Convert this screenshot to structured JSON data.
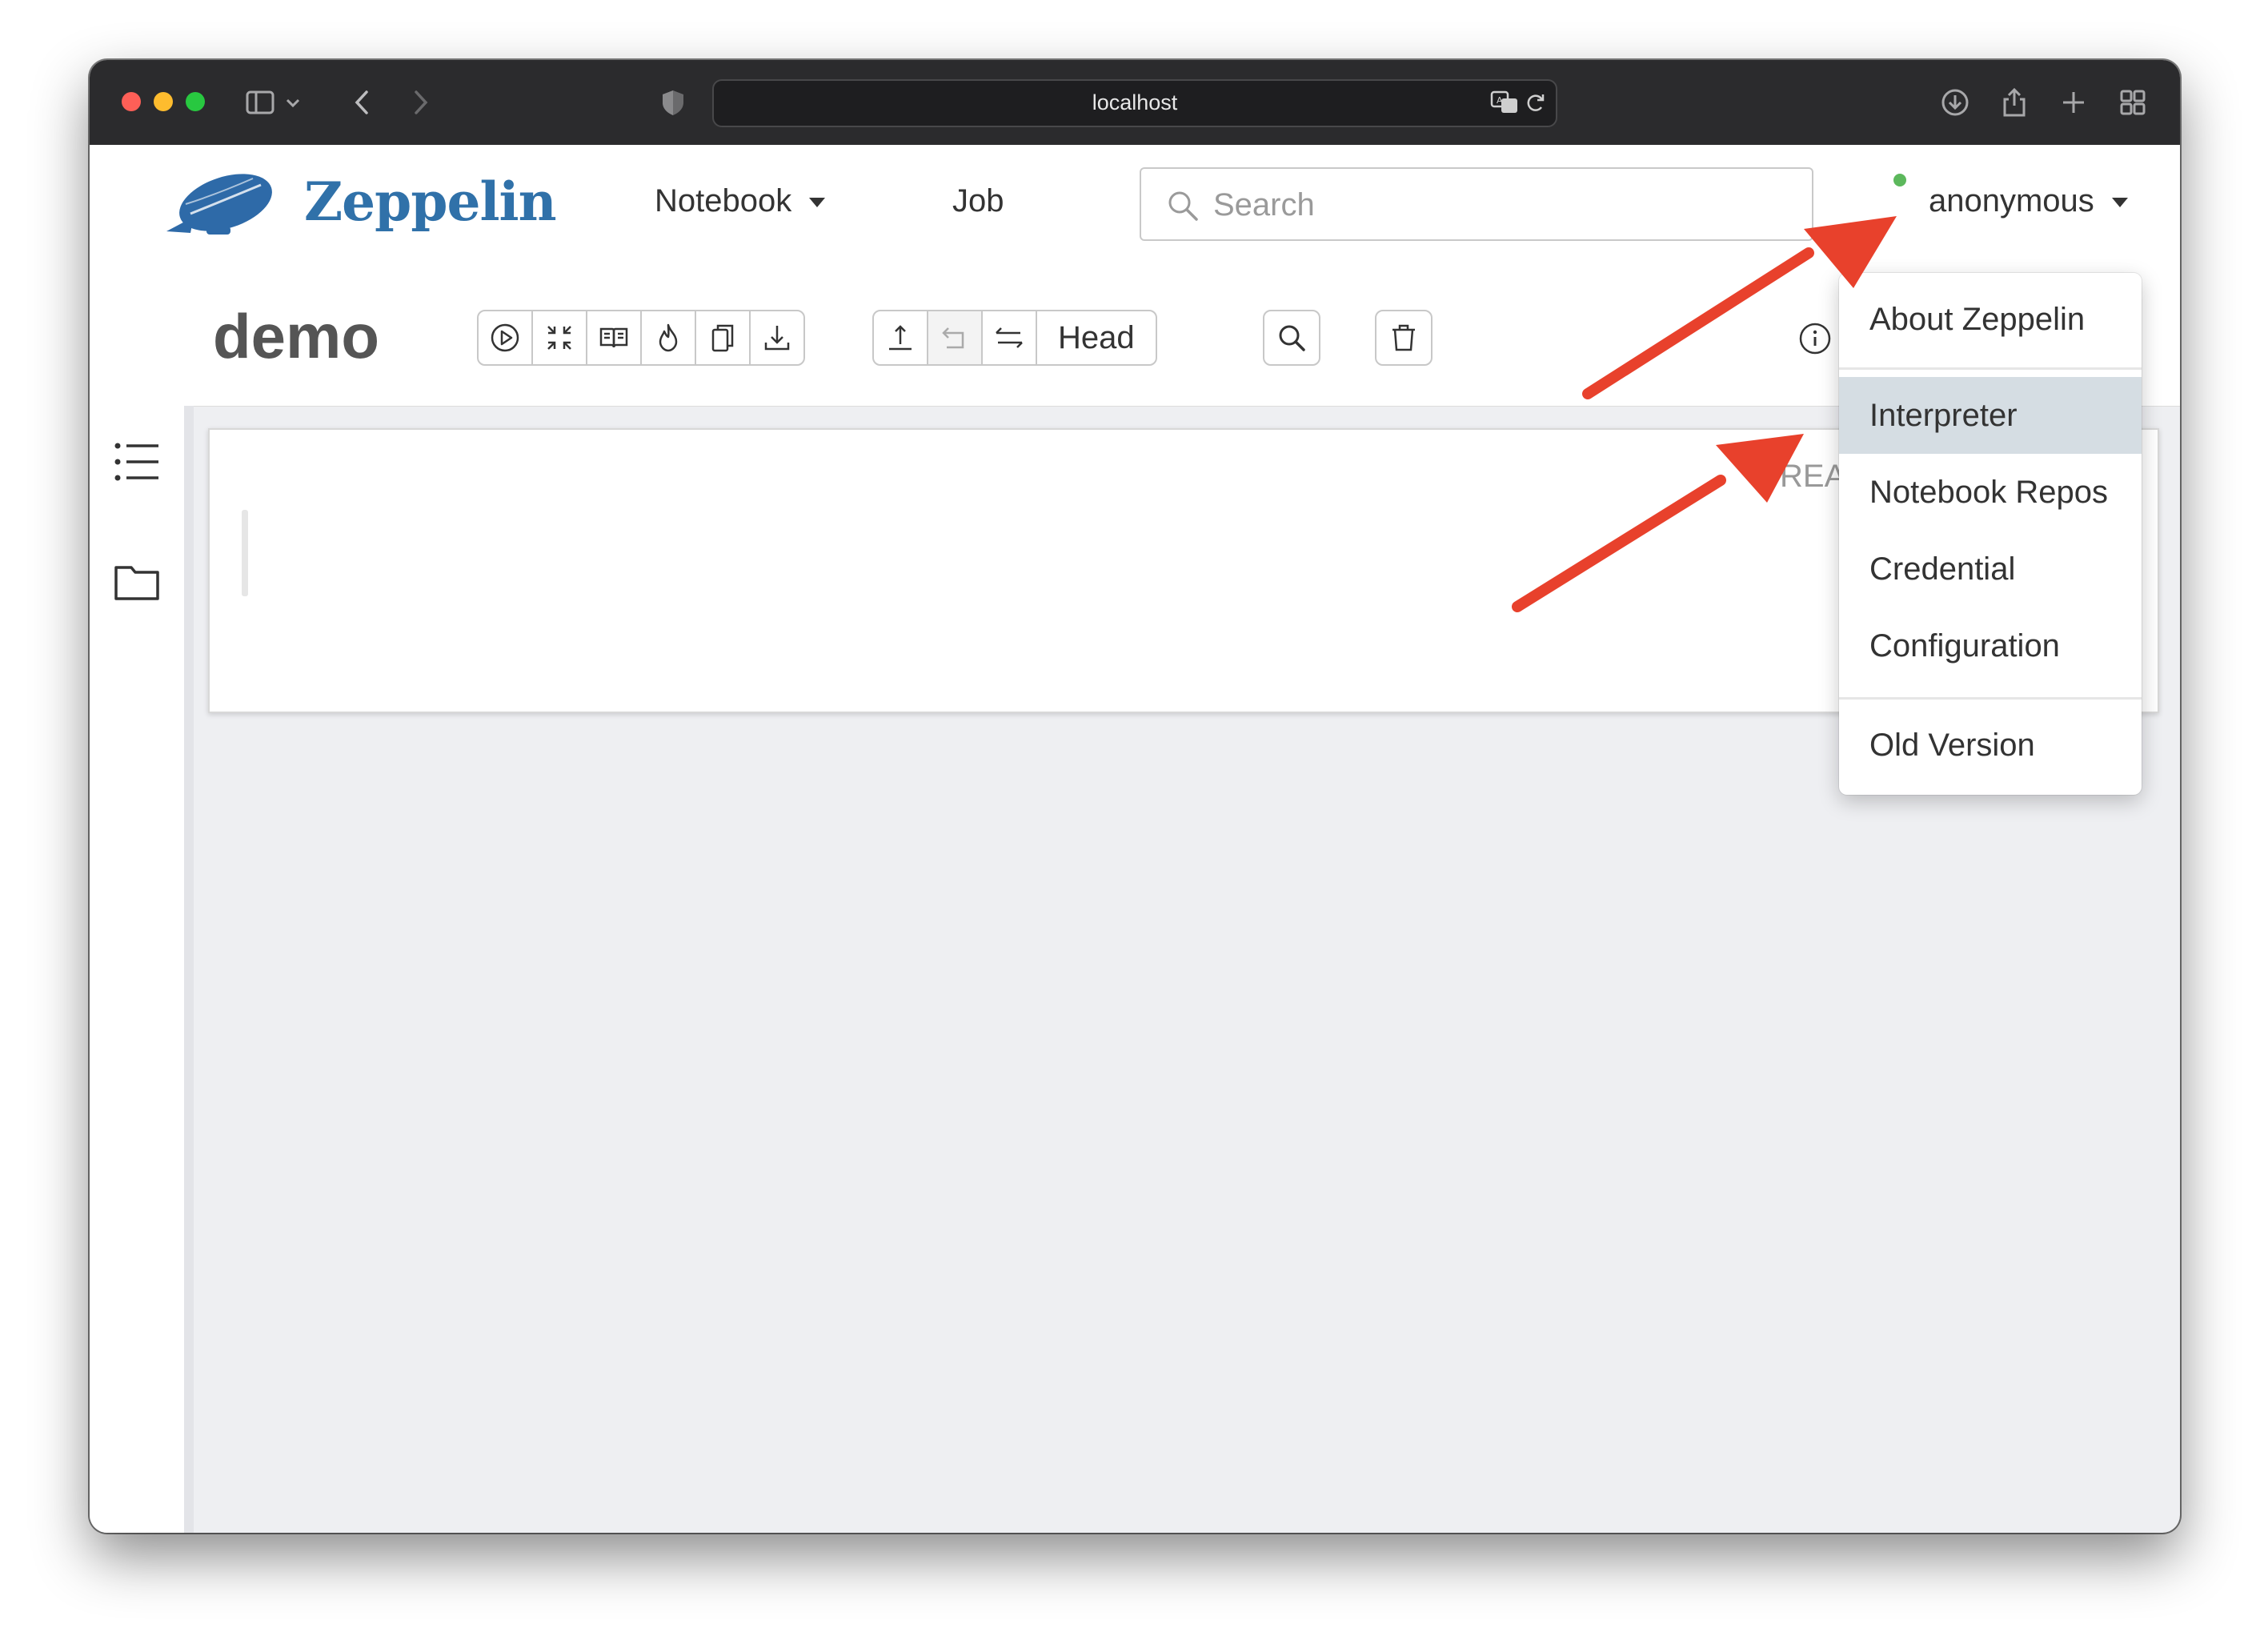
{
  "browser": {
    "url": "localhost"
  },
  "navbar": {
    "brand": "Zeppelin",
    "notebook_label": "Notebook",
    "job_label": "Job",
    "search_placeholder": "Search",
    "user_label": "anonymous",
    "user_status_color": "#5cb85c"
  },
  "notebook": {
    "title": "demo",
    "head_label": "Head",
    "paragraph_status": "REA"
  },
  "user_menu": {
    "items": [
      "About Zeppelin",
      "Interpreter",
      "Notebook Repos",
      "Credential",
      "Configuration",
      "Old Version"
    ],
    "highlighted": "Interpreter"
  },
  "colors": {
    "brand": "#3071a9",
    "annotation_arrow": "#e8412c",
    "menu_highlight": "#d5dde3"
  },
  "icons": [
    "sidebar-toggle-icon",
    "chevron-down-icon",
    "back-icon",
    "forward-icon",
    "privacy-shield-icon",
    "translate-icon",
    "reload-icon",
    "download-icon",
    "share-icon",
    "new-tab-icon",
    "tab-overview-icon",
    "zeppelin-logo",
    "search-icon",
    "run-all-icon",
    "toggle-editor-icon",
    "toggle-output-icon",
    "clear-output-icon",
    "clone-note-icon",
    "export-note-icon",
    "commit-icon",
    "revert-icon",
    "compare-icon",
    "find-icon",
    "trash-icon",
    "info-icon",
    "toc-icon",
    "folder-icon"
  ]
}
